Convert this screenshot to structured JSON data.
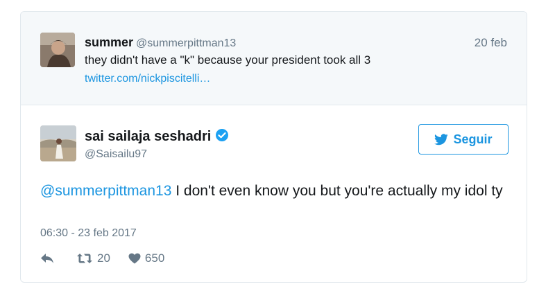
{
  "quoted_tweet": {
    "author_name": "summer",
    "author_handle": "@summerpittman13",
    "date": "20 feb",
    "text": "they didn't have a \"k\" because your president took all 3",
    "link": "twitter.com/nickpiscitelli…"
  },
  "tweet": {
    "author_name": "sai sailaja seshadri",
    "author_handle": "@Saisailu97",
    "verified": true,
    "follow_label": "Seguir",
    "mention": "@summerpittman13",
    "text": " I don't even know you but you're actually my idol ty",
    "timestamp": "06:30 - 23 feb 2017",
    "retweet_count": "20",
    "like_count": "650"
  },
  "icons": {
    "verified": "verified-badge-icon",
    "follow": "twitter-bird-icon",
    "reply": "reply-icon",
    "retweet": "retweet-icon",
    "like": "heart-icon"
  },
  "colors": {
    "accent": "#1b95e0",
    "muted": "#657786",
    "text": "#14171a",
    "quoted_bg": "#f5f8fa",
    "border": "#e1e8ed",
    "verified": "#1da1f2"
  }
}
